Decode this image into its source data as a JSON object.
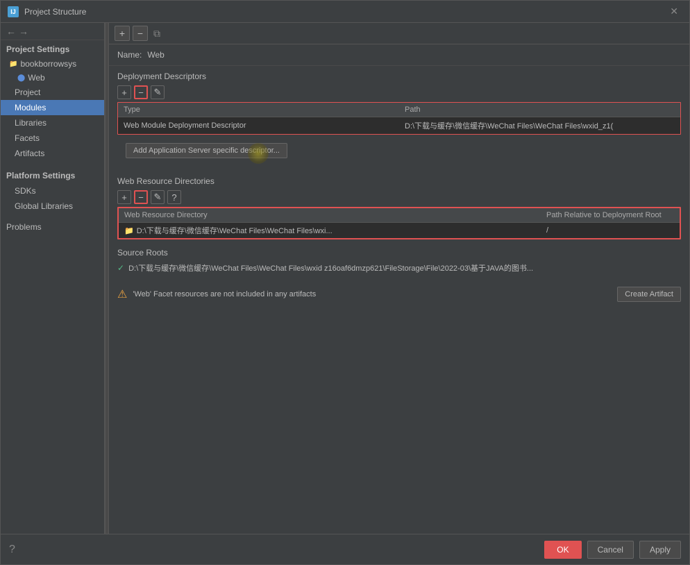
{
  "dialog": {
    "title": "Project Structure",
    "title_icon_text": "IJ"
  },
  "sidebar": {
    "nav_back": "←",
    "nav_forward": "→",
    "project_settings_label": "Project Settings",
    "items": [
      {
        "id": "project",
        "label": "Project",
        "active": false
      },
      {
        "id": "modules",
        "label": "Modules",
        "active": true
      },
      {
        "id": "libraries",
        "label": "Libraries",
        "active": false
      },
      {
        "id": "facets",
        "label": "Facets",
        "active": false
      },
      {
        "id": "artifacts",
        "label": "Artifacts",
        "active": false
      }
    ],
    "platform_label": "Platform Settings",
    "platform_items": [
      {
        "id": "sdks",
        "label": "SDKs",
        "active": false
      },
      {
        "id": "global-libraries",
        "label": "Global Libraries",
        "active": false
      }
    ],
    "problems_label": "Problems",
    "tree": {
      "project_name": "bookborrowsys",
      "module_name": "Web"
    }
  },
  "content": {
    "name_label": "Name:",
    "name_value": "Web",
    "toolbar": {
      "add_label": "+",
      "remove_label": "−",
      "copy_label": "⧉"
    },
    "deployment_descriptors": {
      "section_title": "Deployment Descriptors",
      "add_btn": "+",
      "remove_btn": "−",
      "edit_btn": "✎",
      "table_headers": {
        "type": "Type",
        "path": "Path"
      },
      "rows": [
        {
          "type": "Web Module Deployment Descriptor",
          "path": "D:\\下载与缓存\\微信缓存\\WeChat Files\\WeChat Files\\wxid_z1("
        }
      ],
      "add_descriptor_btn": "Add Application Server specific descriptor..."
    },
    "web_resource_directories": {
      "section_title": "Web Resource Directories",
      "add_btn": "+",
      "remove_btn": "−",
      "edit_btn": "✎",
      "help_btn": "?",
      "table_headers": {
        "directory": "Web Resource Directory",
        "relative": "Path Relative to Deployment Root"
      },
      "rows": [
        {
          "directory": "D:\\下载与缓存\\微信缓存\\WeChat Files\\WeChat Files\\wxi...",
          "relative": "/"
        }
      ]
    },
    "source_roots": {
      "section_title": "Source Roots",
      "items": [
        {
          "checked": true,
          "path": "D:\\下载与缓存\\微信缓存\\WeChat Files\\WeChat Files\\wxid z16oaf6dmzp621\\FileStorage\\File\\2022-03\\基于JAVA的图书..."
        }
      ]
    },
    "warning": {
      "text": "'Web' Facet resources are not included in any artifacts",
      "create_artifact_btn": "Create Artifact"
    }
  },
  "footer": {
    "help_label": "?",
    "ok_label": "OK",
    "cancel_label": "Cancel",
    "apply_label": "Apply"
  }
}
